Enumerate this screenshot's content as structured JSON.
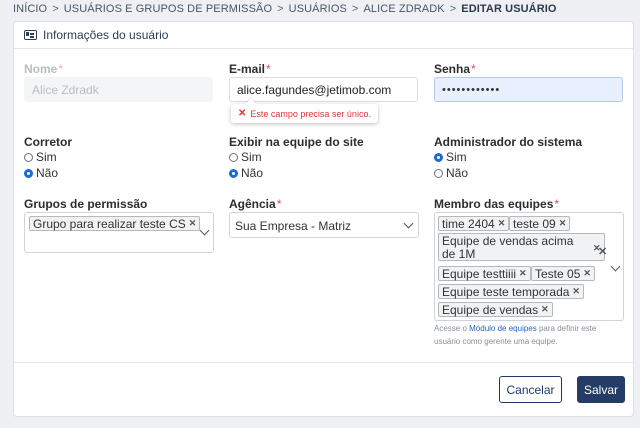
{
  "breadcrumb": {
    "items": [
      "INÍCIO",
      "USUÁRIOS E GRUPOS DE PERMISSÃO",
      "USUÁRIOS",
      "ALICE ZDRADK",
      "EDITAR USUÁRIO"
    ],
    "separator": ">"
  },
  "card": {
    "title": "Informações do usuário",
    "icon": "id-card-icon"
  },
  "form": {
    "nome": {
      "label": "Nome",
      "value": "Alice Zdradk"
    },
    "email": {
      "label": "E-mail",
      "value": "alice.fagundes@jetimob.com",
      "error": "Este campo precisa ser único."
    },
    "senha": {
      "label": "Senha",
      "value": "••••••••••••"
    },
    "corretor": {
      "label": "Corretor",
      "options": [
        "Sim",
        "Não"
      ],
      "selected": "Não"
    },
    "exibir": {
      "label": "Exibir na equipe do site",
      "options": [
        "Sim",
        "Não"
      ],
      "selected": "Não"
    },
    "admin": {
      "label": "Administrador do sistema",
      "options": [
        "Sim",
        "Não"
      ],
      "selected": "Sim"
    },
    "grupos": {
      "label": "Grupos de permissão",
      "tags": [
        "Grupo para realizar teste CS"
      ]
    },
    "agencia": {
      "label": "Agência",
      "value": "Sua Empresa - Matriz"
    },
    "equipes": {
      "label": "Membro das equipes",
      "tags": [
        "time 2404",
        "teste 09",
        "Equipe de vendas acima de 1M",
        "Equipe testtiiii",
        "Teste 05",
        "Equipe teste temporada",
        "Equipe de vendas"
      ],
      "help_prefix": "Acesse o",
      "help_link": "Módulo de equipes",
      "help_suffix": "para definir este usuário como gerente uma equipe."
    }
  },
  "actions": {
    "cancel": "Cancelar",
    "save": "Salvar"
  },
  "colors": {
    "primary": "#243c66",
    "error": "#d8363b",
    "radio": "#1b6ad9"
  }
}
